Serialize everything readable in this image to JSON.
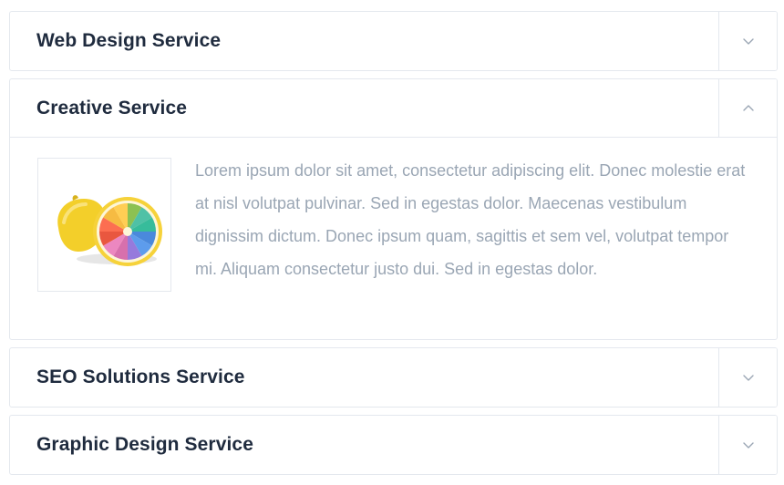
{
  "accordion": {
    "items": [
      {
        "title": "Web Design Service",
        "expanded": false,
        "toggle_icon": "chevron-down-icon"
      },
      {
        "title": "Creative Service",
        "expanded": true,
        "toggle_icon": "chevron-up-icon",
        "image_icon": "lemon-color-wheel-icon",
        "body": "Lorem ipsum dolor sit amet, consectetur adipiscing elit. Donec molestie erat at nisl volutpat pulvinar. Sed in egestas dolor. Maecenas vestibulum dignissim dictum. Donec ipsum quam, sagittis et sem vel, volutpat tempor mi. Aliquam consectetur justo dui. Sed in egestas dolor."
      },
      {
        "title": "SEO Solutions Service",
        "expanded": false,
        "toggle_icon": "chevron-down-icon"
      },
      {
        "title": "Graphic Design Service",
        "expanded": false,
        "toggle_icon": "chevron-down-icon"
      }
    ]
  },
  "colors": {
    "title": "#1f2b3e",
    "body_text": "#9aa6b4",
    "border": "#e4e8ee",
    "chevron": "#9aa6b4"
  }
}
